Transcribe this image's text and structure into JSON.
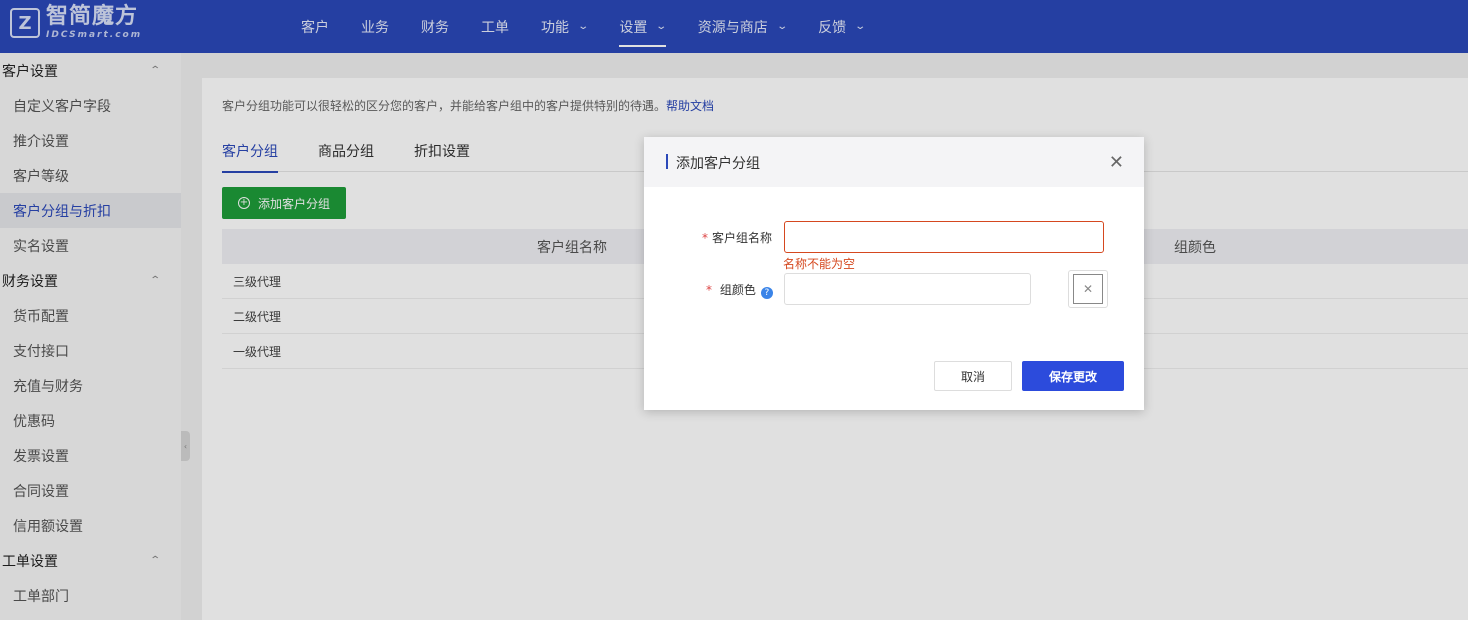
{
  "logo": {
    "cn": "智简魔方",
    "en": "IDCSmart.com",
    "mark": "Z"
  },
  "nav": [
    {
      "label": "客户",
      "chevron": false
    },
    {
      "label": "业务",
      "chevron": false
    },
    {
      "label": "财务",
      "chevron": false
    },
    {
      "label": "工单",
      "chevron": false
    },
    {
      "label": "功能",
      "chevron": true
    },
    {
      "label": "设置",
      "chevron": true,
      "active": true
    },
    {
      "label": "资源与商店",
      "chevron": true
    },
    {
      "label": "反馈",
      "chevron": true
    }
  ],
  "sidebar": {
    "groups": [
      {
        "title": "客户设置",
        "items": [
          "自定义客户字段",
          "推介设置",
          "客户等级",
          "客户分组与折扣",
          "实名设置"
        ]
      },
      {
        "title": "财务设置",
        "items": [
          "货币配置",
          "支付接口",
          "充值与财务",
          "优惠码",
          "发票设置",
          "合同设置",
          "信用额设置"
        ]
      },
      {
        "title": "工单设置",
        "items": [
          "工单部门"
        ]
      }
    ],
    "active": "客户分组与折扣"
  },
  "content": {
    "description": "客户分组功能可以很轻松的区分您的客户，并能给客户组中的客户提供特别的待遇。",
    "help_link": "帮助文档",
    "tabs": [
      "客户分组",
      "商品分组",
      "折扣设置"
    ],
    "add_button": "添加客户分组",
    "table": {
      "headers": [
        "客户组名称",
        "组颜色"
      ],
      "rows": [
        "三级代理",
        "二级代理",
        "一级代理"
      ]
    }
  },
  "modal": {
    "title": "添加客户分组",
    "name_label": "客户组名称",
    "name_value": "",
    "name_error": "名称不能为空",
    "color_label": "组颜色",
    "color_value": "",
    "required_mark": "*",
    "cancel": "取消",
    "save": "保存更改"
  },
  "colors": {
    "brand": "#2b48b9",
    "add_button": "#1e9d3a",
    "save_button": "#2c4bdc",
    "error": "#d5481f"
  }
}
